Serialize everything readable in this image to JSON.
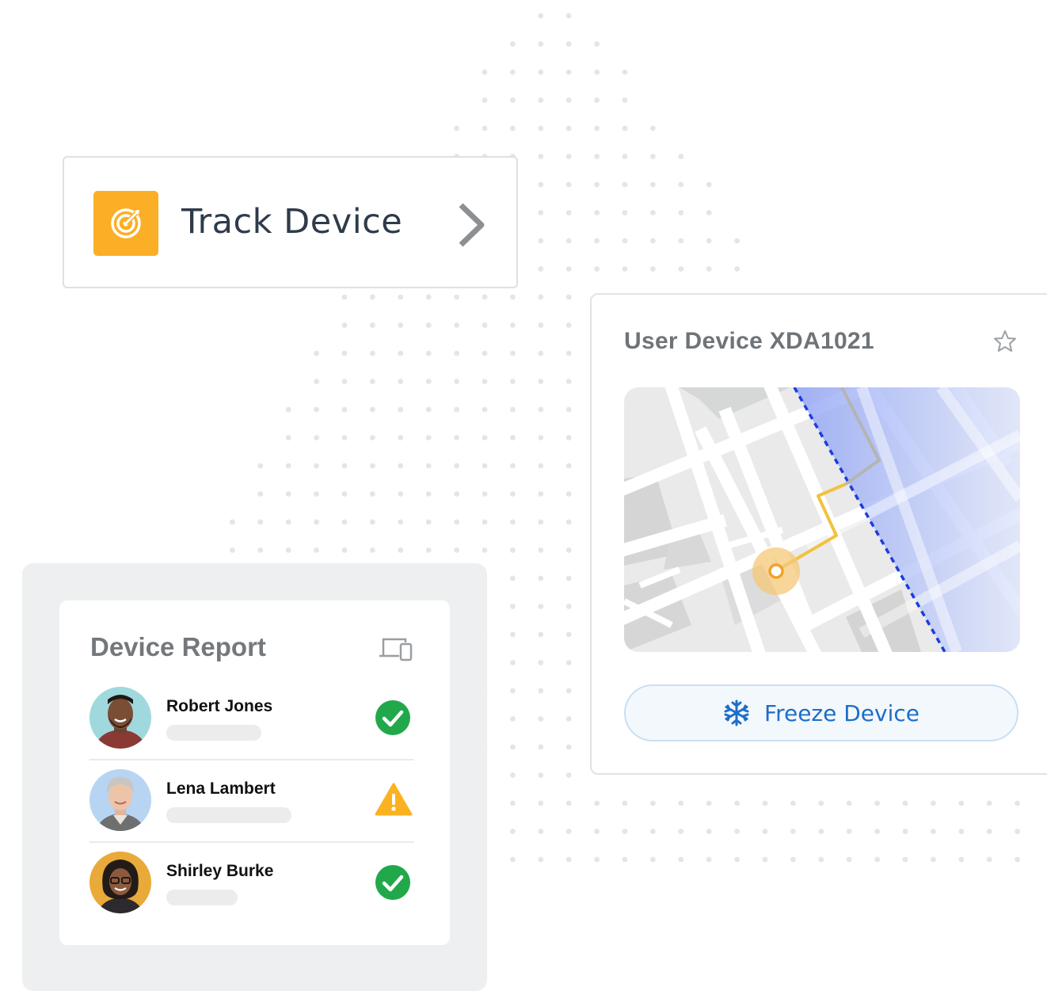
{
  "track_card": {
    "label": "Track Device",
    "icon": "target-icon",
    "accent": "#fbaf26"
  },
  "device_card": {
    "title": "User Device XDA1021",
    "freeze_label": "Freeze Device",
    "accent": "#1c6ec9"
  },
  "report": {
    "title": "Device Report",
    "icon": "devices-icon",
    "people": [
      {
        "name": "Robert Jones",
        "status": "ok"
      },
      {
        "name": "Lena Lambert",
        "status": "warning"
      },
      {
        "name": "Shirley Burke",
        "status": "ok"
      }
    ]
  },
  "colors": {
    "ok": "#21a84b",
    "warning": "#fbb220"
  }
}
